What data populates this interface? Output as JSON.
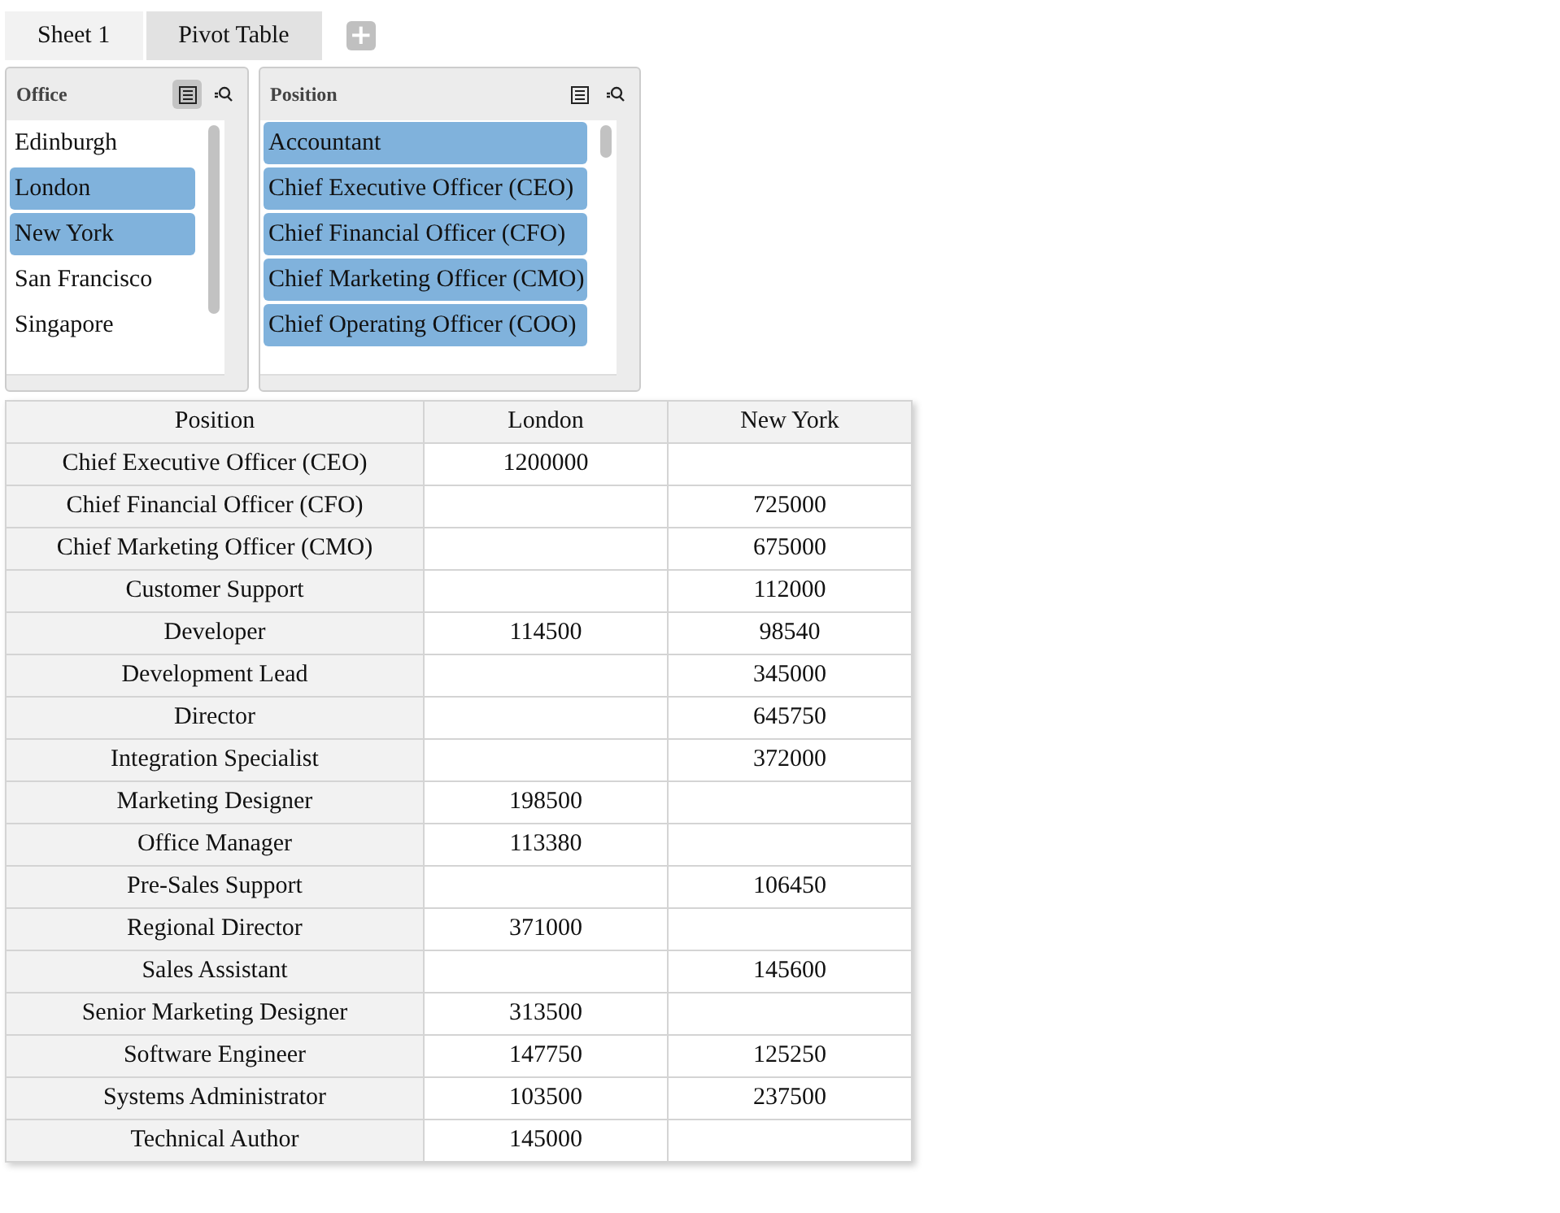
{
  "tabs": [
    {
      "label": "Sheet 1",
      "selected": false
    },
    {
      "label": "Pivot Table",
      "selected": true
    }
  ],
  "add_tab": "+",
  "filters": [
    {
      "title": "Office",
      "list_toggle_on": true,
      "items": [
        {
          "label": "Edinburgh",
          "selected": false
        },
        {
          "label": "London",
          "selected": true
        },
        {
          "label": "New York",
          "selected": true
        },
        {
          "label": "San Francisco",
          "selected": false
        },
        {
          "label": "Singapore",
          "selected": false
        }
      ]
    },
    {
      "title": "Position",
      "list_toggle_on": false,
      "items": [
        {
          "label": "Accountant",
          "selected": true
        },
        {
          "label": "Chief Executive Officer (CEO)",
          "selected": true
        },
        {
          "label": "Chief Financial Officer (CFO)",
          "selected": true
        },
        {
          "label": "Chief Marketing Officer (CMO)",
          "selected": true
        },
        {
          "label": "Chief Operating Officer (COO)",
          "selected": true
        }
      ]
    }
  ],
  "table": {
    "columns": [
      "Position",
      "London",
      "New York"
    ],
    "rows": [
      [
        "Chief Executive Officer (CEO)",
        "1200000",
        ""
      ],
      [
        "Chief Financial Officer (CFO)",
        "",
        "725000"
      ],
      [
        "Chief Marketing Officer (CMO)",
        "",
        "675000"
      ],
      [
        "Customer Support",
        "",
        "112000"
      ],
      [
        "Developer",
        "114500",
        "98540"
      ],
      [
        "Development Lead",
        "",
        "345000"
      ],
      [
        "Director",
        "",
        "645750"
      ],
      [
        "Integration Specialist",
        "",
        "372000"
      ],
      [
        "Marketing Designer",
        "198500",
        ""
      ],
      [
        "Office Manager",
        "113380",
        ""
      ],
      [
        "Pre-Sales Support",
        "",
        "106450"
      ],
      [
        "Regional Director",
        "371000",
        ""
      ],
      [
        "Sales Assistant",
        "",
        "145600"
      ],
      [
        "Senior Marketing Designer",
        "313500",
        ""
      ],
      [
        "Software Engineer",
        "147750",
        "125250"
      ],
      [
        "Systems Administrator",
        "103500",
        "237500"
      ],
      [
        "Technical Author",
        "145000",
        ""
      ]
    ]
  }
}
